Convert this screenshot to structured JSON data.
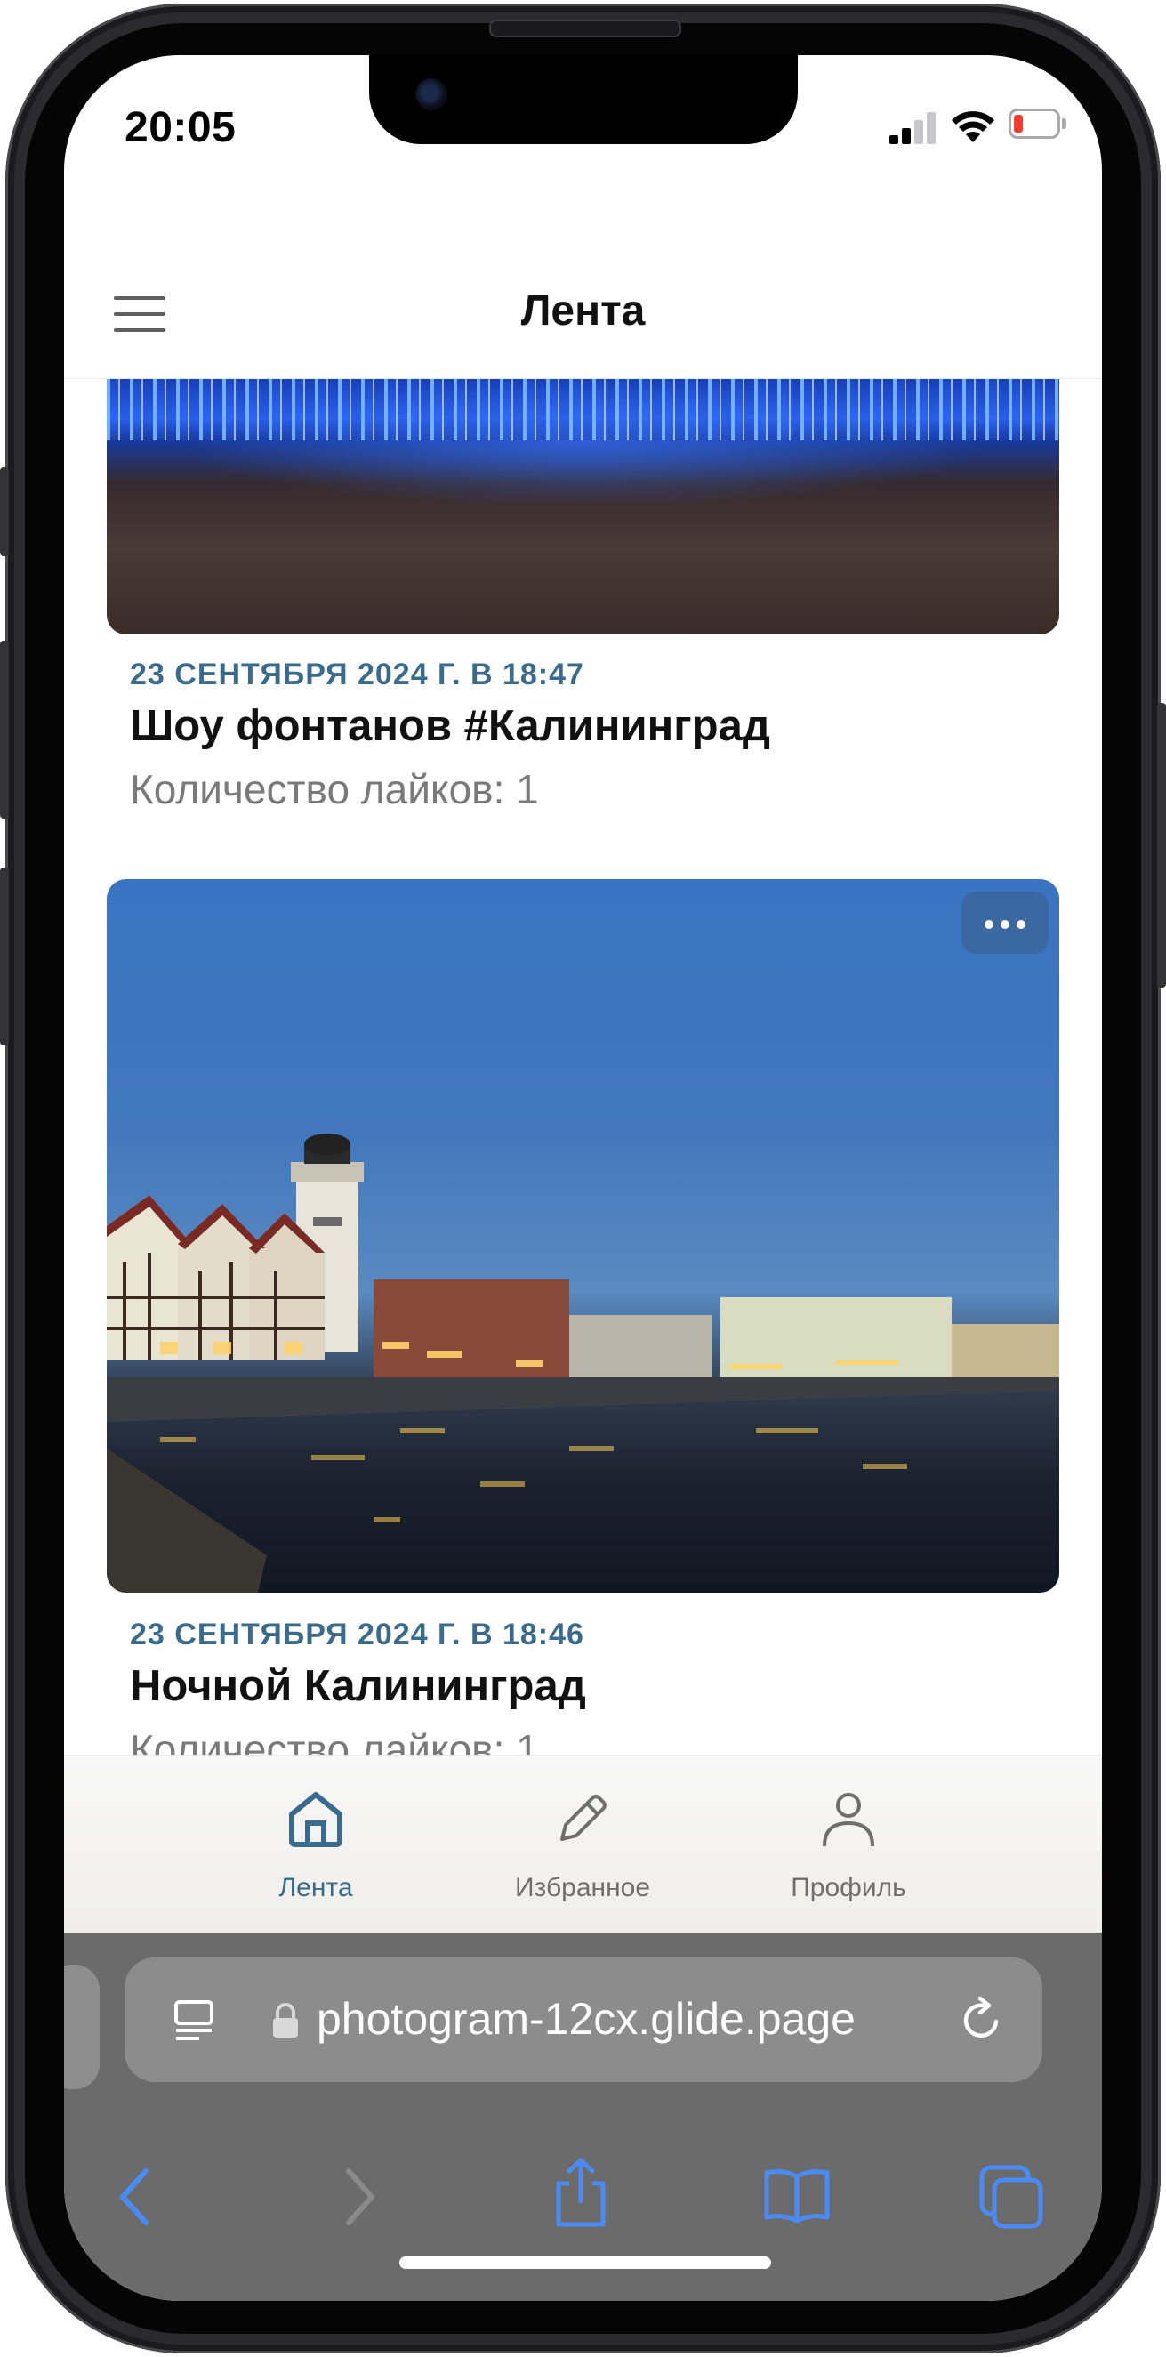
{
  "status_bar": {
    "time": "20:05"
  },
  "header": {
    "title": "Лента"
  },
  "posts": [
    {
      "date": "23 СЕНТЯБРЯ 2024 Г. В 18:47",
      "title": "Шоу фонтанов #Калининград",
      "likes": "Количество лайков: 1"
    },
    {
      "date": "23 СЕНТЯБРЯ 2024 Г. В 18:46",
      "title": "Ночной Калининград",
      "likes": "Количество лайков: 1"
    }
  ],
  "tabbar": {
    "items": [
      {
        "label": "Лента",
        "icon": "home-icon",
        "active": true
      },
      {
        "label": "Избранное",
        "icon": "pencil-icon",
        "active": false
      },
      {
        "label": "Профиль",
        "icon": "person-icon",
        "active": false
      }
    ]
  },
  "browser": {
    "url": "photogram-12cx.glide.page"
  },
  "colors": {
    "accent": "#3a6a8c",
    "safari_icons": "#4a8cf7"
  }
}
